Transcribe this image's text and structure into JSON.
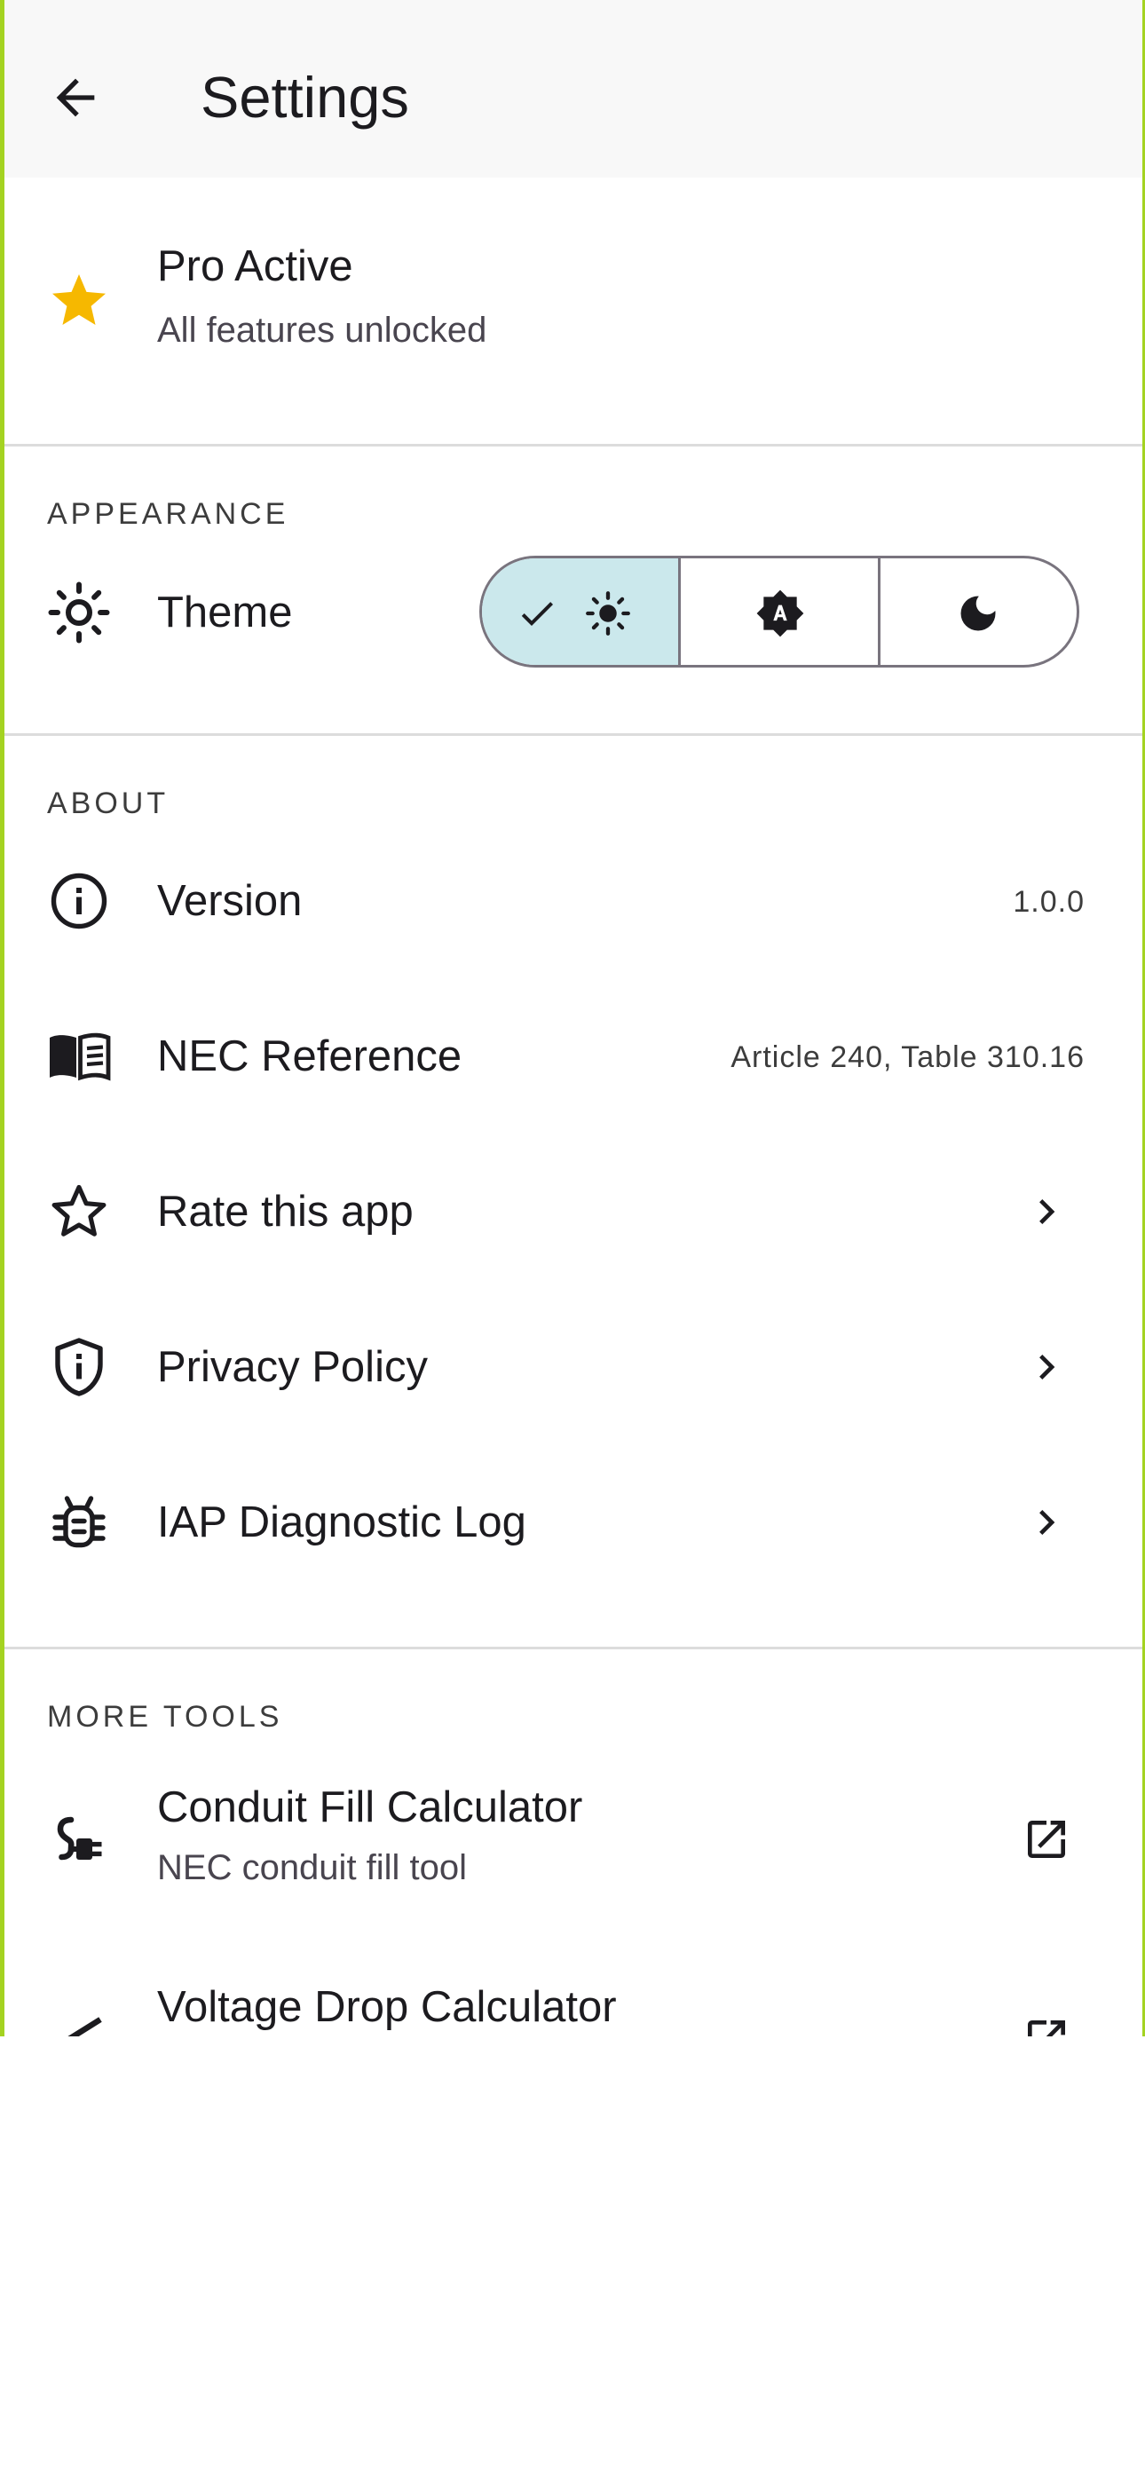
{
  "appbar": {
    "title": "Settings",
    "back_icon": "arrow-left-icon"
  },
  "pro": {
    "title": "Pro Active",
    "subtitle": "All features unlocked",
    "icon": "star-icon",
    "icon_color": "#f6b800"
  },
  "appearance": {
    "section_label": "APPEARANCE",
    "theme": {
      "label": "Theme",
      "icon": "sun-icon"
    },
    "theme_options": [
      {
        "name": "light",
        "selected": true,
        "icon": "sun-icon"
      },
      {
        "name": "auto",
        "selected": false,
        "icon": "brightness-auto-icon"
      },
      {
        "name": "dark",
        "selected": false,
        "icon": "moon-icon"
      }
    ],
    "selected_color": "#cbe8ec"
  },
  "about": {
    "section_label": "ABOUT",
    "version": {
      "label": "Version",
      "value": "1.0.0"
    },
    "nec": {
      "label": "NEC Reference",
      "value": "Article 240, Table 310.16"
    },
    "rate": {
      "label": "Rate this app"
    },
    "privacy": {
      "label": "Privacy Policy"
    },
    "iap": {
      "label": "IAP Diagnostic Log"
    }
  },
  "more_tools": {
    "section_label": "MORE TOOLS",
    "items": [
      {
        "title": "Conduit Fill Calculator",
        "subtitle": "NEC conduit fill tool"
      },
      {
        "title": "Voltage Drop Calculator"
      }
    ]
  },
  "colors": {
    "frame_border": "#a4d321",
    "appbar_bg": "#f8f8f8"
  }
}
